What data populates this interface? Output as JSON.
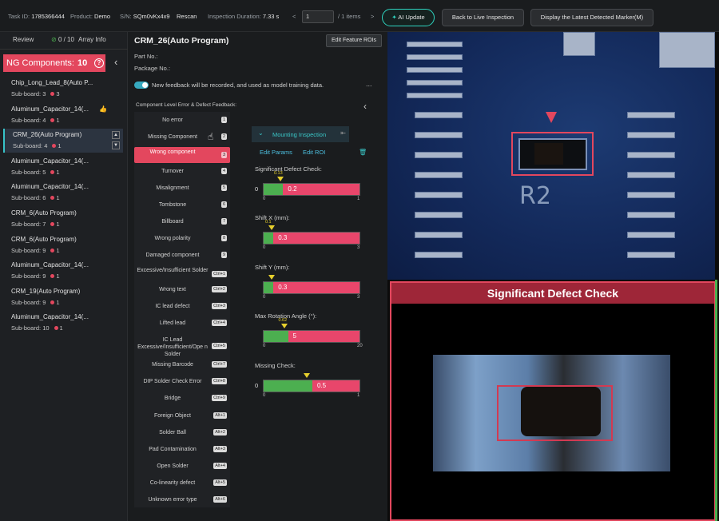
{
  "topbar": {
    "task_label": "Task ID:",
    "task_value": "1785366444",
    "product_label": "Product:",
    "product_value": "Demo",
    "sn_label": "S/N:",
    "sn_value": "SQm0vKx4x9",
    "rescan": "Rescan",
    "duration_label": "Inspection Duration:",
    "duration_value": "7.33 s",
    "page_value": "1",
    "page_total": "/ 1 items",
    "ai_update": "AI Update",
    "back_live": "Back to Live Inspection",
    "display_latest": "Display the Latest Detected Marker(M)"
  },
  "left": {
    "tab_review": "Review",
    "progress": "0 / 10",
    "tab_array": "Array Info",
    "ng_label": "NG Components:",
    "ng_count": "10",
    "items": [
      {
        "name": "Chip_Long_Lead_8(Auto P...",
        "sub": "Sub-board: 3",
        "count": "3"
      },
      {
        "name": "Aluminum_Capacitor_14(...",
        "sub": "Sub-board: 4",
        "count": "1"
      },
      {
        "name": "CRM_26(Auto Program)",
        "sub": "Sub-board: 4",
        "count": "1"
      },
      {
        "name": "Aluminum_Capacitor_14(...",
        "sub": "Sub-board: 5",
        "count": "1"
      },
      {
        "name": "Aluminum_Capacitor_14(...",
        "sub": "Sub-board: 6",
        "count": "1"
      },
      {
        "name": "CRM_6(Auto Program)",
        "sub": "Sub-board: 7",
        "count": "1"
      },
      {
        "name": "CRM_6(Auto Program)",
        "sub": "Sub-board: 9",
        "count": "1"
      },
      {
        "name": "Aluminum_Capacitor_14(...",
        "sub": "Sub-board: 9",
        "count": "1"
      },
      {
        "name": "CRM_19(Auto Program)",
        "sub": "Sub-board: 9",
        "count": "1"
      },
      {
        "name": "Aluminum_Capacitor_14(...",
        "sub": "Sub-board: 10",
        "count": "1"
      }
    ]
  },
  "mid": {
    "title": "CRM_26(Auto Program)",
    "edit_feature": "Edit Feature ROIs",
    "part_no": "Part No.:",
    "package_no": "Package No.:",
    "feedback_note": "New feedback will be recorded, and used as model training data.",
    "more": "...",
    "error_head": "Component Level Error & Defect Feedback:",
    "errors": [
      {
        "label": "No error",
        "key": "1"
      },
      {
        "label": "Missing Component",
        "key": "2"
      },
      {
        "label": "Wrong component",
        "key": "3"
      },
      {
        "label": "Turnover",
        "key": "4"
      },
      {
        "label": "Misalignment",
        "key": "5"
      },
      {
        "label": "Tombstone",
        "key": "6"
      },
      {
        "label": "Billboard",
        "key": "7"
      },
      {
        "label": "Wrong polarity",
        "key": "8"
      },
      {
        "label": "Damaged component",
        "key": "9"
      },
      {
        "label": "Excessive/Insufficient Solder",
        "key": "Ctrl+1"
      },
      {
        "label": "Wrong text",
        "key": "Ctrl+2"
      },
      {
        "label": "IC lead defect",
        "key": "Ctrl+3"
      },
      {
        "label": "Lifted lead",
        "key": "Ctrl+4"
      },
      {
        "label": "IC Lead Excessive/Insufficient/Ope n Solder",
        "key": "Ctrl+5"
      },
      {
        "label": "Missing Barcode",
        "key": "Ctrl+7"
      },
      {
        "label": "DIP Solder Check Error",
        "key": "Ctrl+8"
      },
      {
        "label": "Bridge",
        "key": "Ctrl+9"
      },
      {
        "label": "Foreign Object",
        "key": "Alt+1"
      },
      {
        "label": "Solder Ball",
        "key": "Alt+2"
      },
      {
        "label": "Pad Contamination",
        "key": "Alt+3"
      },
      {
        "label": "Open Solder",
        "key": "Alt+4"
      },
      {
        "label": "Co-linearity defect",
        "key": "Alt+5"
      },
      {
        "label": "Unknown error type",
        "key": "Alt+6"
      }
    ],
    "insp_title": "Mounting Inspection",
    "edit_params": "Edit Params",
    "edit_roi": "Edit ROI",
    "metrics": [
      {
        "label": "Significant Defect Check:",
        "value": "0.2",
        "fill": 0.2,
        "min": "0",
        "max": "1",
        "marker": "0.13",
        "zero": "0"
      },
      {
        "label": "Shift X (mm):",
        "value": "0.3",
        "fill": 0.1,
        "min": "0",
        "max": "3",
        "marker": "0.1",
        "zero": ""
      },
      {
        "label": "Shift Y (mm):",
        "value": "0.3",
        "fill": 0.1,
        "min": "0",
        "max": "3",
        "marker": "",
        "zero": ""
      },
      {
        "label": "Max Rotation Angle (°):",
        "value": "5",
        "fill": 0.25,
        "min": "0",
        "max": "20",
        "marker": "0.62",
        "zero": ""
      },
      {
        "label": "Missing Check:",
        "value": "0.5",
        "fill": 0.5,
        "min": "0",
        "max": "1",
        "marker": "",
        "zero": "0"
      }
    ]
  },
  "right": {
    "silk_text": "R2",
    "detail_title": "Significant Defect Check"
  },
  "colors": {
    "accent": "#37c3c8",
    "ng": "#e3475e",
    "ok": "#4caf50"
  }
}
